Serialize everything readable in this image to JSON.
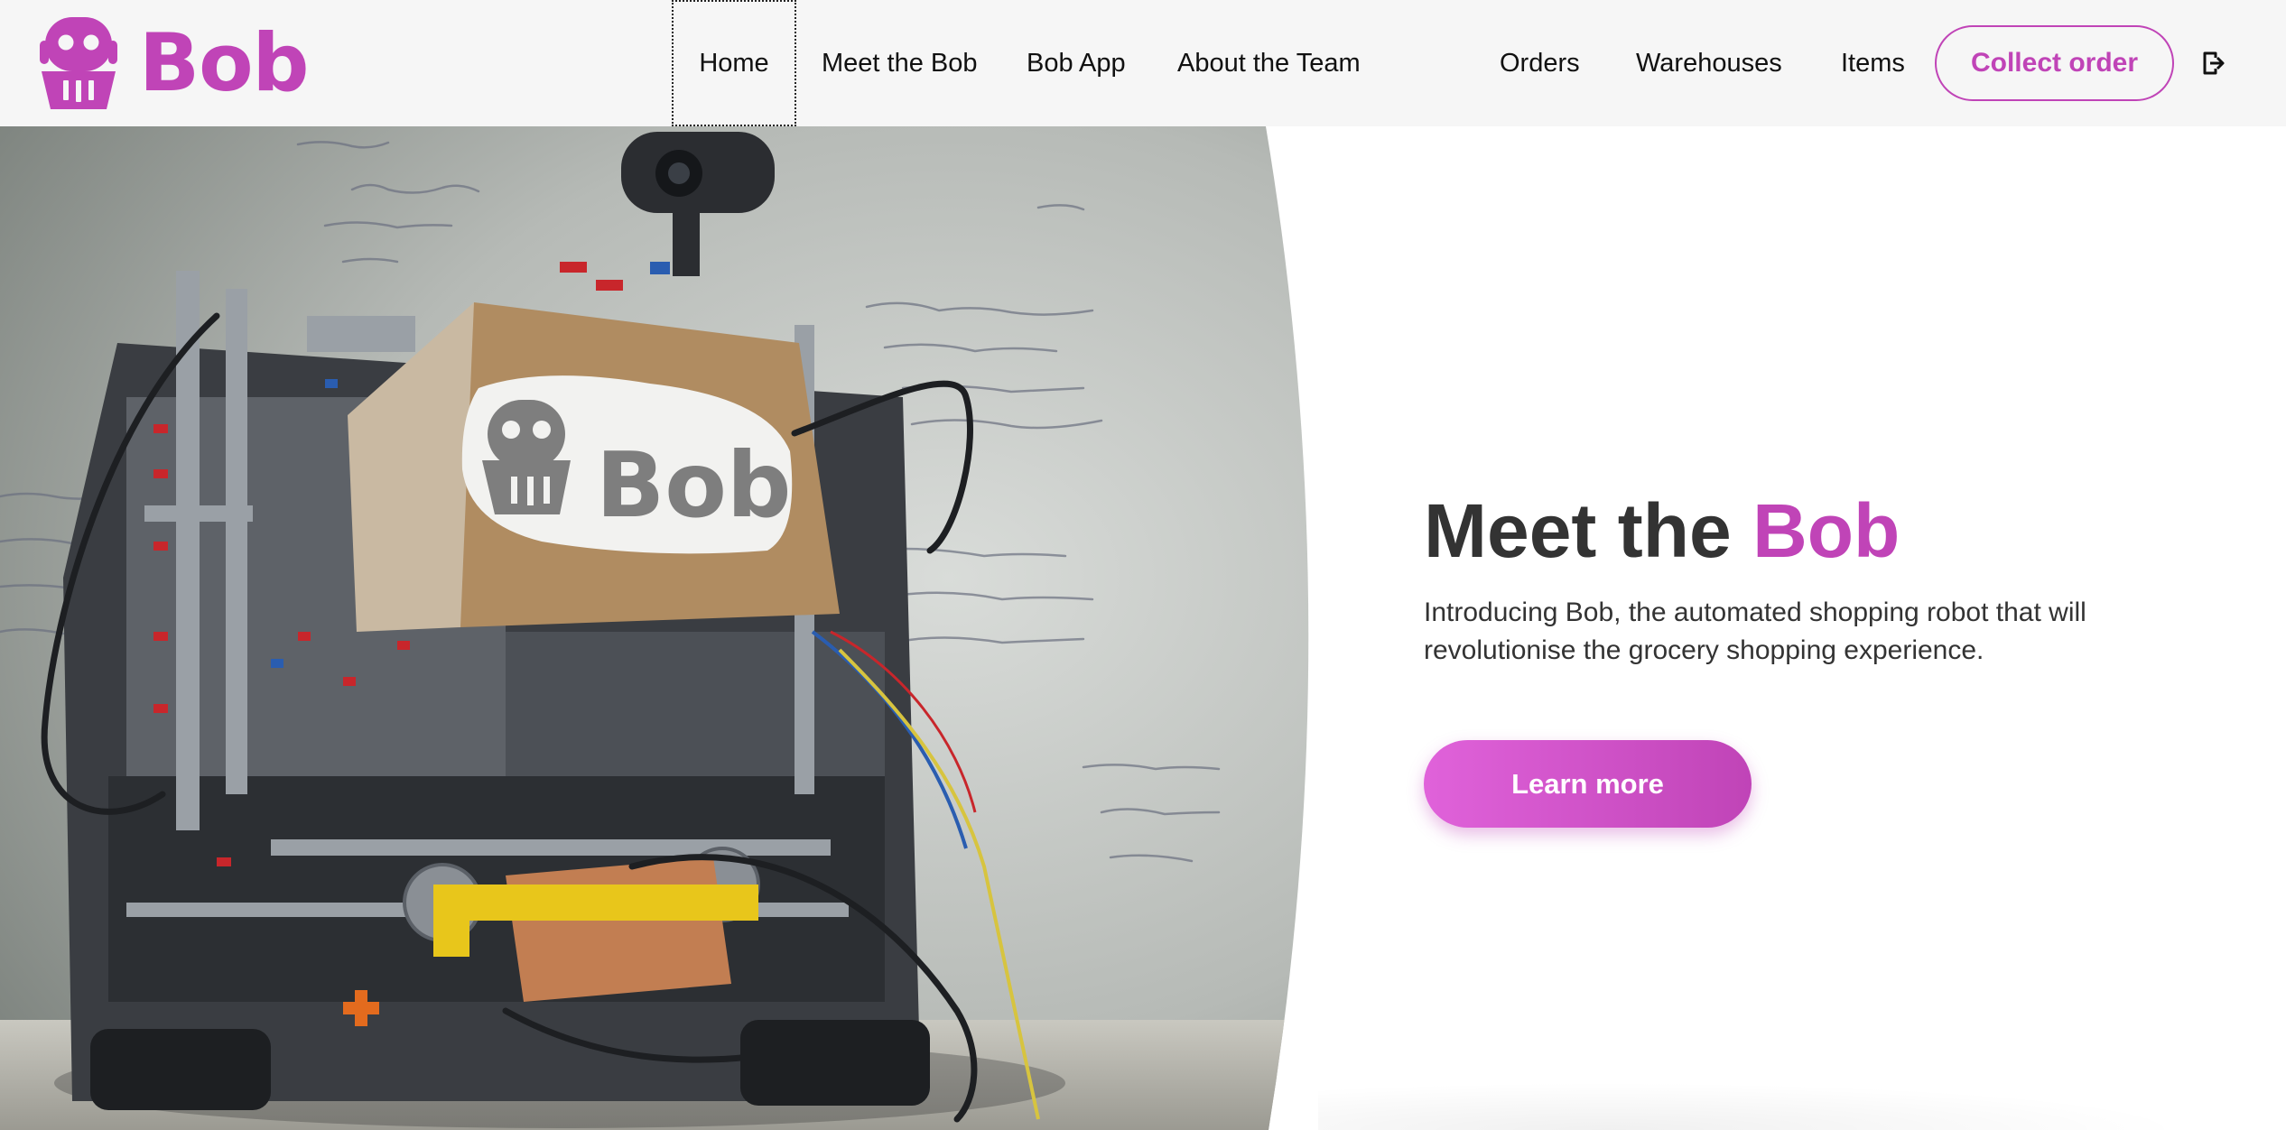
{
  "brand": {
    "name": "Bob",
    "icon": "robot-icon",
    "color": "#c044b7"
  },
  "nav": {
    "primary": [
      {
        "label": "Home",
        "focused": true
      },
      {
        "label": "Meet the Bob"
      },
      {
        "label": "Bob App"
      },
      {
        "label": "About the Team"
      }
    ],
    "secondary": [
      {
        "label": "Orders"
      },
      {
        "label": "Warehouses"
      },
      {
        "label": "Items"
      }
    ],
    "collect_order_label": "Collect order",
    "logout_icon": "logout-icon"
  },
  "hero": {
    "title_prefix": "Meet the ",
    "title_accent": "Bob",
    "subtitle": "Introducing Bob, the automated shopping robot that will revolutionise the grocery shopping experience.",
    "cta_label": "Learn more",
    "photo_sign_text": "Bob"
  },
  "colors": {
    "accent": "#c044b7",
    "accent_light": "#e062da",
    "nav_background": "#f6f6f6",
    "heading_text": "#333333"
  }
}
